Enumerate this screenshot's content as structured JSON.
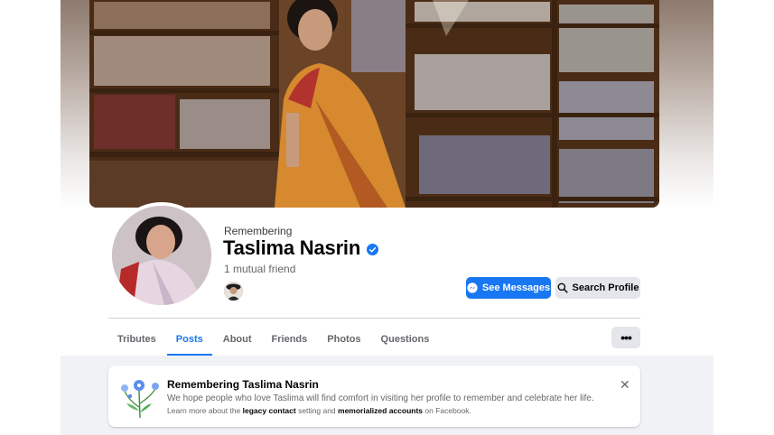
{
  "profile": {
    "remembering_label": "Remembering",
    "name": "Taslima Nasrin",
    "mutual_friends": "1 mutual friend",
    "verified_icon": "verified-badge-icon"
  },
  "actions": {
    "messages_label": "See Messages",
    "search_label": "Search Profile"
  },
  "tabs": [
    {
      "label": "Tributes"
    },
    {
      "label": "Posts",
      "active": true
    },
    {
      "label": "About"
    },
    {
      "label": "Friends"
    },
    {
      "label": "Photos"
    },
    {
      "label": "Questions"
    }
  ],
  "more_label": "•••",
  "memorial_card": {
    "title": "Remembering Taslima Nasrin",
    "line1": "We hope people who love Taslima will find comfort in visiting her profile to remember and celebrate her life.",
    "line2_prefix": "Learn more about the ",
    "line2_link1": "legacy contact",
    "line2_mid": " setting and ",
    "line2_link2": "memorialized accounts",
    "line2_suffix": " on Facebook.",
    "close_label": "✕"
  },
  "colors": {
    "accent": "#1877f2",
    "button_gray": "#e4e6eb",
    "page_bg": "#f0f2f5"
  }
}
